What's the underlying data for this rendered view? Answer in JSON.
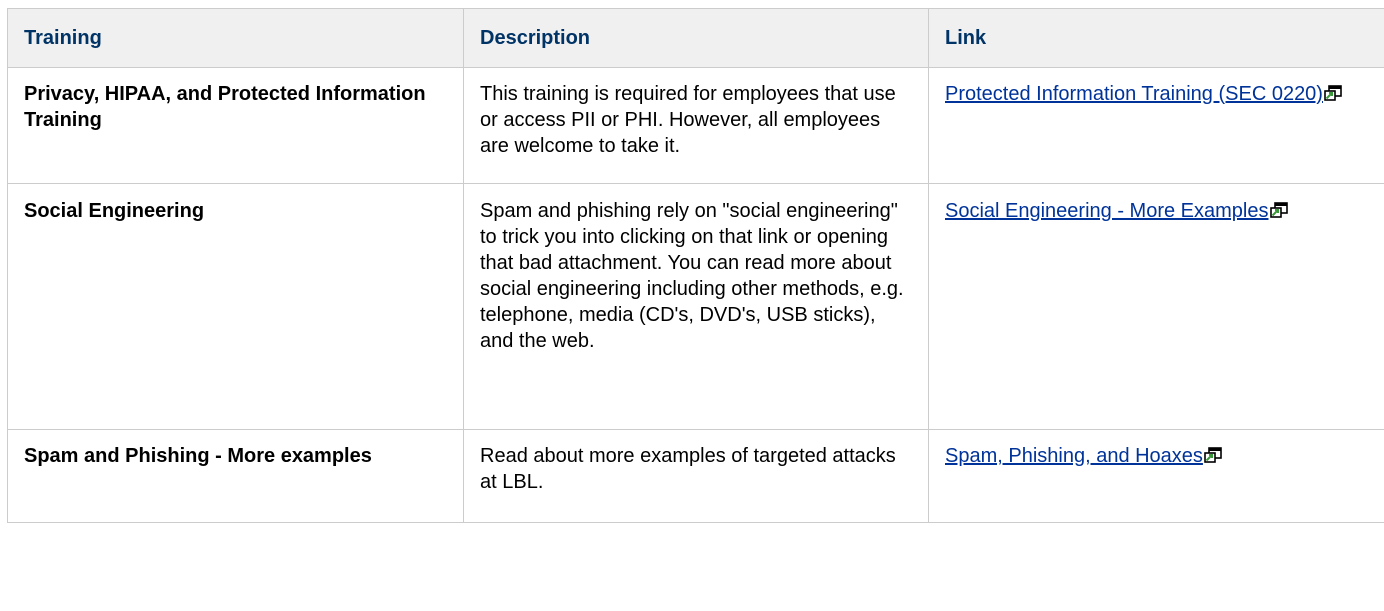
{
  "table": {
    "headers": {
      "training": "Training",
      "description": "Description",
      "link": "Link"
    },
    "rows": [
      {
        "training": "Privacy, HIPAA, and Protected Information Training",
        "description": "This training is required for employees that use or access PII or PHI. However, all employees are welcome to take it.",
        "link": "Protected Information Training (SEC 0220)"
      },
      {
        "training": "Social Engineering",
        "description": "Spam and phishing rely on \"social engineering\" to trick you into clicking on that link or opening that bad attachment. You can read more about social engineering including other methods, e.g. telephone, media (CD's, DVD's, USB sticks), and the web.",
        "link": "Social Engineering - More Examples"
      },
      {
        "training": "Spam and Phishing - More examples",
        "description": "Read about more examples of targeted attacks at LBL.",
        "link": "Spam, Phishing, and Hoaxes"
      }
    ]
  },
  "icons": {
    "external_link": "external-link-icon"
  },
  "colors": {
    "header_bg": "#f0f0f0",
    "header_text": "#003366",
    "link": "#003399",
    "border": "#cccccc"
  }
}
